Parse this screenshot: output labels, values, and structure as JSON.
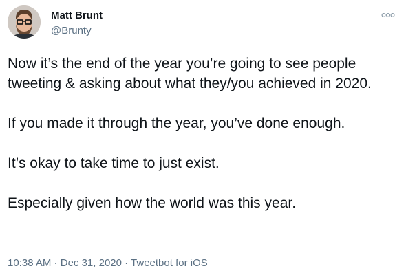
{
  "author": {
    "name": "Matt Brunt",
    "handle": "@Brunty"
  },
  "tweet": {
    "paragraphs": [
      "Now it’s the end of the year you’re going to see people tweeting & asking about what they/you achieved in 2020.",
      "If you made it through the year, you’ve done enough.",
      "It’s okay to take time to just exist.",
      "Especially given how the world was this year."
    ]
  },
  "meta": {
    "time": "10:38 AM",
    "separator": " · ",
    "date": "Dec 31, 2020",
    "source": "Tweetbot for iOS"
  },
  "icons": {
    "more": "more-options-icon"
  },
  "colors": {
    "text": "#0f1419",
    "secondary": "#5b7083"
  }
}
